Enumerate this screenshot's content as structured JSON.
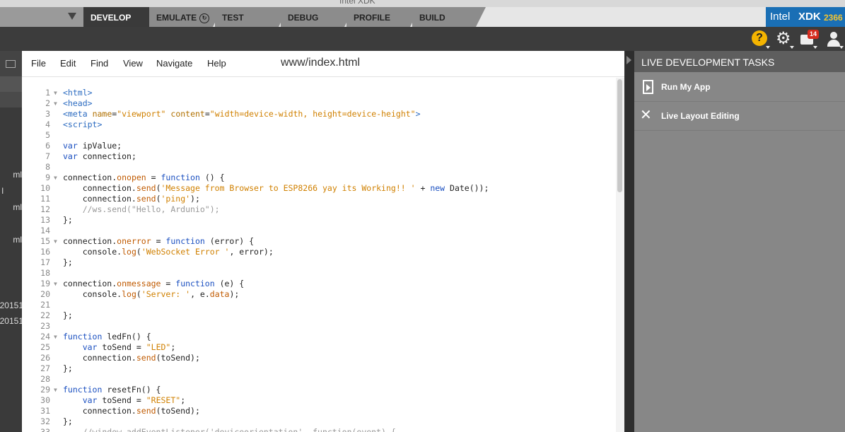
{
  "window": {
    "title": "Intel XDK"
  },
  "tabs": [
    {
      "label": "DEVELOP",
      "active": true
    },
    {
      "label": "EMULATE",
      "active": false
    },
    {
      "label": "TEST",
      "active": false
    },
    {
      "label": "DEBUG",
      "active": false
    },
    {
      "label": "PROFILE",
      "active": false
    },
    {
      "label": "BUILD",
      "active": false
    }
  ],
  "brand": {
    "intel": "Intel",
    "product": "XDK",
    "version": "2366"
  },
  "toolbar": {
    "notifications_count": "14",
    "help_icon": "help-icon",
    "settings_icon": "gear-icon",
    "chat_icon": "chat-icon",
    "user_icon": "user-icon"
  },
  "sidebar": {
    "items": [
      "ml",
      "l",
      "ml",
      "ml",
      "20151",
      "20151"
    ]
  },
  "editor": {
    "menu": [
      "File",
      "Edit",
      "Find",
      "View",
      "Navigate",
      "Help"
    ],
    "filename": "www/index.html"
  },
  "code_lines": [
    "<html>",
    "<head>",
    "<meta name=\"viewport\" content=\"width=device-width, height=device-height\">",
    "<script>",
    "",
    "var ipValue;",
    "var connection;",
    "",
    "connection.onopen = function () {",
    "    connection.send('Message from Browser to ESP8266 yay its Working!! ' + new Date());",
    "    connection.send('ping');",
    "    //ws.send(\"Hello, Ardunio\");",
    "};",
    "",
    "connection.onerror = function (error) {",
    "    console.log('WebSocket Error ', error);",
    "};",
    "",
    "connection.onmessage = function (e) {",
    "    console.log('Server: ', e.data);",
    "",
    "};",
    "",
    "function ledFn() {",
    "    var toSend = \"LED\";",
    "    connection.send(toSend);",
    "};",
    "",
    "function resetFn() {",
    "    var toSend = \"RESET\";",
    "    connection.send(toSend);",
    "};",
    "    //window.addEventListener('deviceorientation', function(event) {"
  ],
  "folds": [
    1,
    2,
    9,
    15,
    19,
    24,
    29
  ],
  "right_panel": {
    "title": "LIVE DEVELOPMENT TASKS",
    "tasks": [
      "Run My App",
      "Live Layout Editing"
    ]
  }
}
